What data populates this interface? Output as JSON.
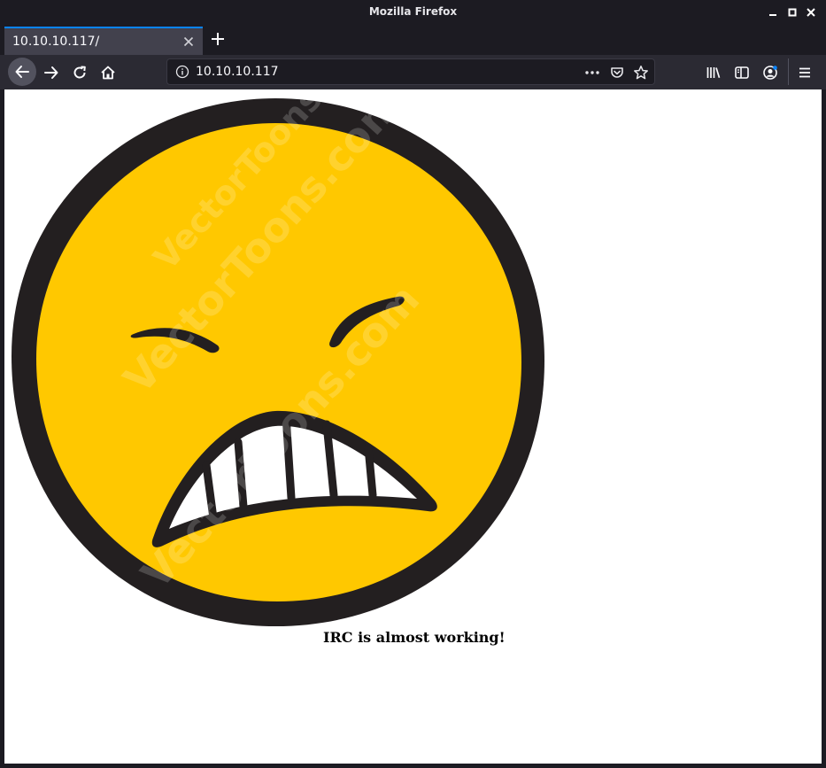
{
  "window": {
    "title": "Mozilla Firefox"
  },
  "tabs": [
    {
      "label": "10.10.10.117/",
      "active": true
    }
  ],
  "urlbar": {
    "url": "10.10.10.117"
  },
  "icons": {
    "back": "arrow-left-icon",
    "forward": "arrow-right-icon",
    "reload": "reload-icon",
    "home": "home-icon",
    "page_actions": "more-dots-icon",
    "pocket": "pocket-icon",
    "bookmark": "star-icon",
    "library": "library-icon",
    "sidebar": "sidebar-icon",
    "account": "account-icon",
    "menu": "hamburger-menu-icon"
  },
  "page": {
    "image": "angry-face-emoji",
    "watermark": "VectorToons.com",
    "caption": "IRC is almost working!"
  },
  "colors": {
    "chrome_dark": "#1c1b22",
    "toolbar": "#2b2a33",
    "tab_active": "#42414d",
    "accent": "#0a84ff",
    "face_yellow": "#ffc800",
    "face_outline": "#231f20"
  }
}
